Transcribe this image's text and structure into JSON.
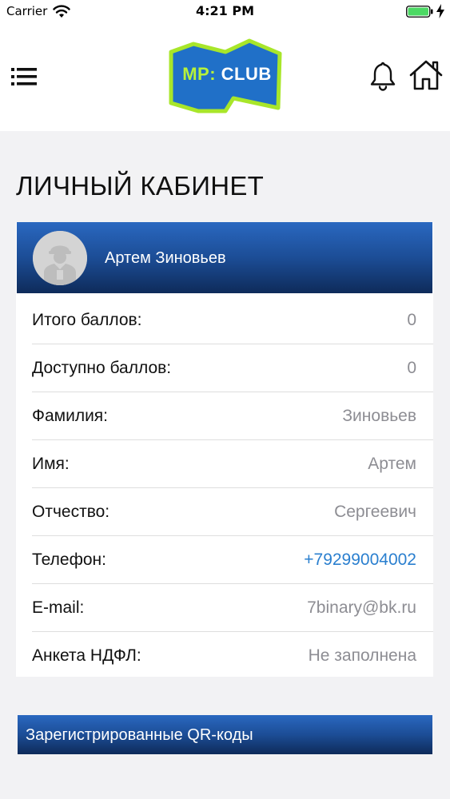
{
  "status_bar": {
    "carrier": "Carrier",
    "time": "4:21 PM"
  },
  "header": {
    "logo_mp": "MP:",
    "logo_club": "CLUB",
    "logo_colors": {
      "frame": "#a8e62a",
      "fill": "#2070c8"
    },
    "icons": [
      "menu-icon",
      "bell-icon",
      "home-icon"
    ]
  },
  "page": {
    "title": "ЛИЧНЫЙ КАБИНЕТ"
  },
  "profile": {
    "name": "Артем Зиновьев",
    "rows": [
      {
        "label": "Итого баллов:",
        "value": "0"
      },
      {
        "label": "Доступно баллов:",
        "value": "0"
      },
      {
        "label": "Фамилия:",
        "value": "Зиновьев"
      },
      {
        "label": "Имя:",
        "value": "Артем"
      },
      {
        "label": "Отчество:",
        "value": "Сергеевич"
      },
      {
        "label": "Телефон:",
        "value": "+79299004002"
      },
      {
        "label": "E-mail:",
        "value": "7binary@bk.ru"
      },
      {
        "label": "Анкета НДФЛ:",
        "value": "Не заполнена"
      }
    ]
  },
  "qr": {
    "title": "Зарегистрированные QR-коды"
  },
  "colors": {
    "header_gradient_top": "#2a68c0",
    "header_gradient_bottom": "#0e2b5a",
    "link": "#2a7fcf",
    "value_gray": "#8d8d93"
  }
}
